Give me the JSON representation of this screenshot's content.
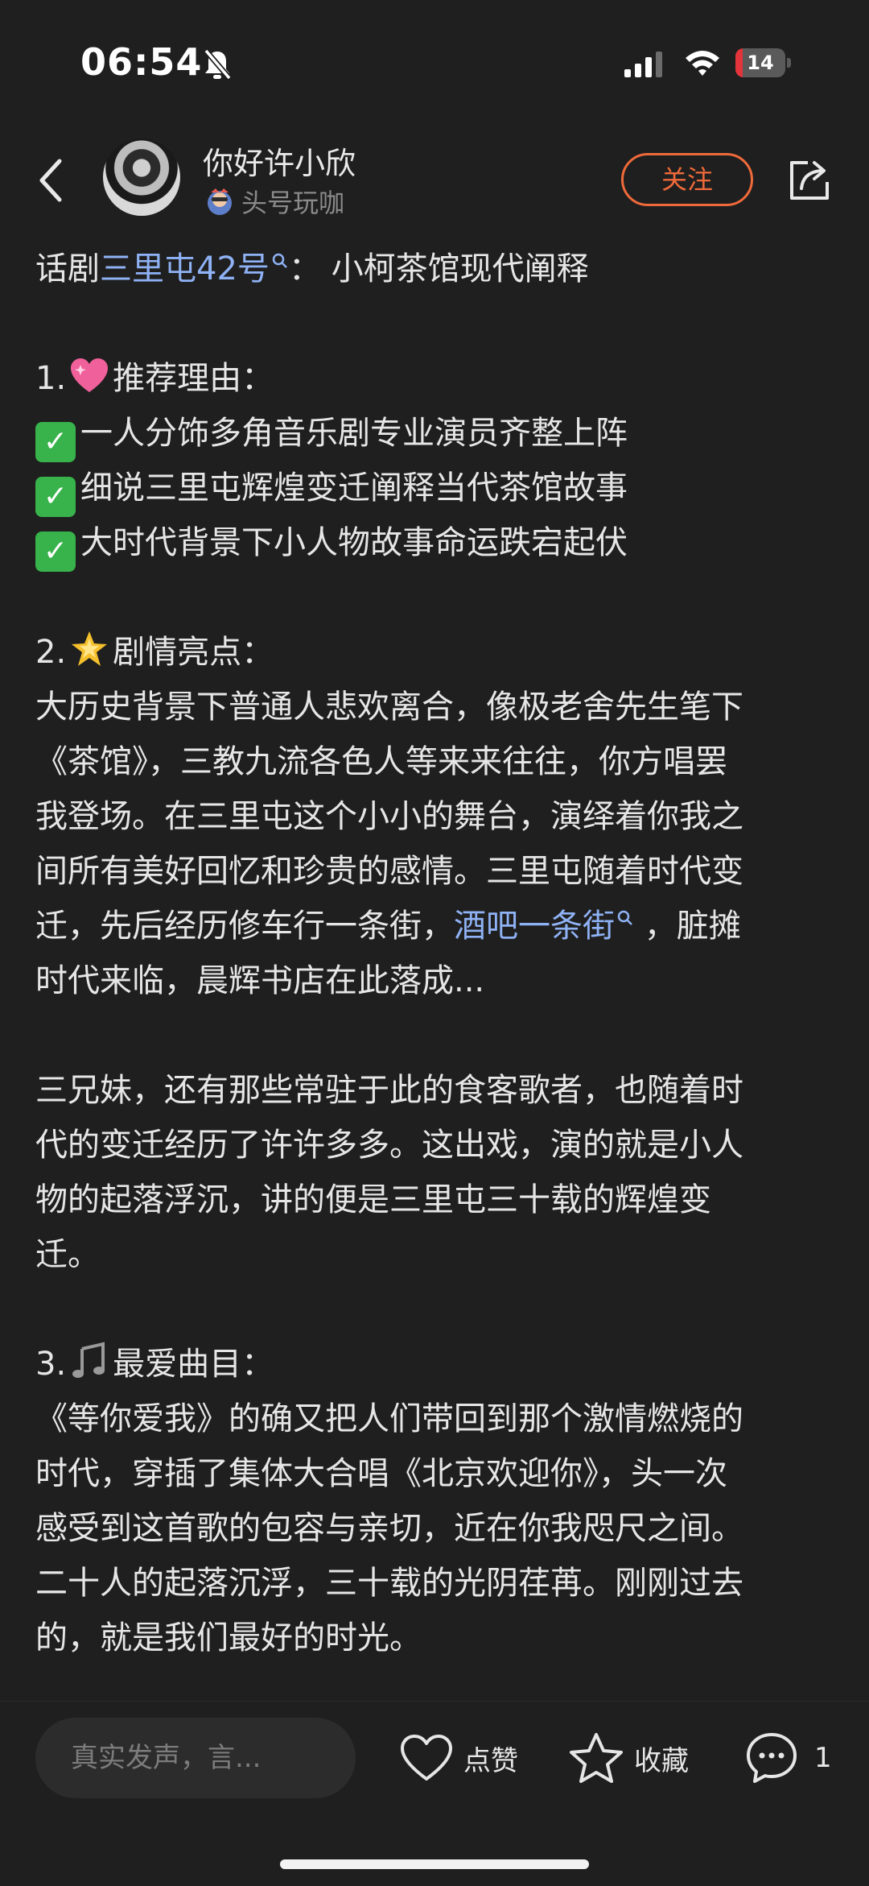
{
  "status_bar": {
    "time": "06:54",
    "battery": "14",
    "battery_level": 0.14
  },
  "header": {
    "author": "你好许小欣",
    "badge": "头号玩咖",
    "follow": "关注"
  },
  "post": {
    "title": {
      "prefix": "话剧",
      "link": "三里屯42号",
      "suffix": "： 小柯茶馆现代阐释"
    },
    "sec1": {
      "num": "1.",
      "label": "推荐理由：",
      "items": [
        "一人分饰多角音乐剧专业演员齐整上阵",
        "细说三里屯辉煌变迁阐释当代茶馆故事",
        "大时代背景下小人物故事命运跌宕起伏"
      ]
    },
    "sec2": {
      "num": "2.",
      "label": "剧情亮点：",
      "lines": [
        "大历史背景下普通人悲欢离合，像极老舍先生笔下",
        "《茶馆》，三教九流各色人等来来往往，你方唱罢",
        "我登场。在三里屯这个小小的舞台，演绎着你我之",
        "间所有美好回忆和珍贵的感情。三里屯随着时代变"
      ],
      "line5_pre": "迁，先后经历修车行一条街，",
      "line5_link": "酒吧一条街",
      "line5_post": " ，脏摊",
      "line6": "时代来临，晨辉书店在此落成...",
      "p2": [
        "三兄妹，还有那些常驻于此的食客歌者，也随着时",
        "代的变迁经历了许许多多。这出戏，演的就是小人",
        "物的起落浮沉，讲的便是三里屯三十载的辉煌变",
        "迁。"
      ]
    },
    "sec3": {
      "num": "3.",
      "label": "最爱曲目：",
      "lines": [
        "《等你爱我》的确又把人们带回到那个激情燃烧的",
        "时代，穿插了集体大合唱《北京欢迎你》，头一次",
        "感受到这首歌的包容与亲切，近在你我咫尺之间。",
        "二十人的起落沉浮，三十载的光阴荏苒。刚刚过去",
        "的，就是我们最好的时光。"
      ]
    }
  },
  "bottom_bar": {
    "comment_placeholder": "真实发声，言...",
    "like": "点赞",
    "favorite": "收藏",
    "comment_count": "1"
  },
  "colors": {
    "background": "#1f1f1f",
    "link": "#8fb2f5",
    "follow": "#ef6a3a"
  },
  "icons": [
    "bell-slash-icon",
    "signal-icon",
    "wifi-icon",
    "battery-icon",
    "back-icon",
    "share-icon",
    "search-icon",
    "heart-icon",
    "star-icon",
    "comment-icon",
    "check-icon",
    "sparkle-heart-icon",
    "glowing-star-icon",
    "music-notes-icon"
  ]
}
